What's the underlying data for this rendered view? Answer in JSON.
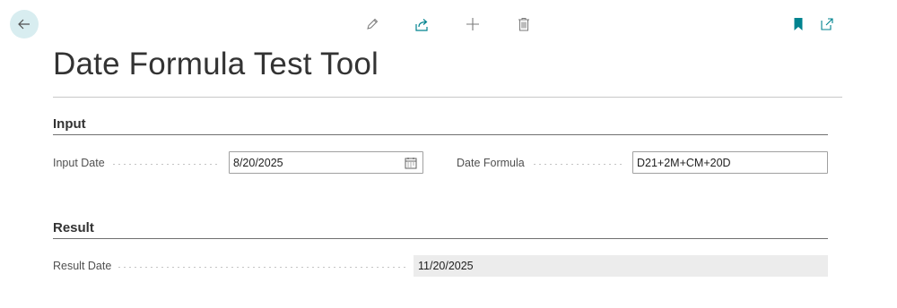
{
  "page": {
    "title": "Date Formula Test Tool"
  },
  "toolbar": {
    "icons": [
      "back-arrow-icon",
      "pencil-icon",
      "share-icon",
      "plus-icon",
      "trash-icon",
      "bookmark-icon",
      "open-new-window-icon"
    ],
    "accent_color": "#00838f"
  },
  "sections": {
    "input": {
      "header": "Input",
      "input_date_label": "Input Date",
      "input_date_value": "8/20/2025",
      "date_formula_label": "Date Formula",
      "date_formula_value": "D21+2M+CM+20D"
    },
    "result": {
      "header": "Result",
      "result_date_label": "Result Date",
      "result_date_value": "11/20/2025"
    }
  }
}
